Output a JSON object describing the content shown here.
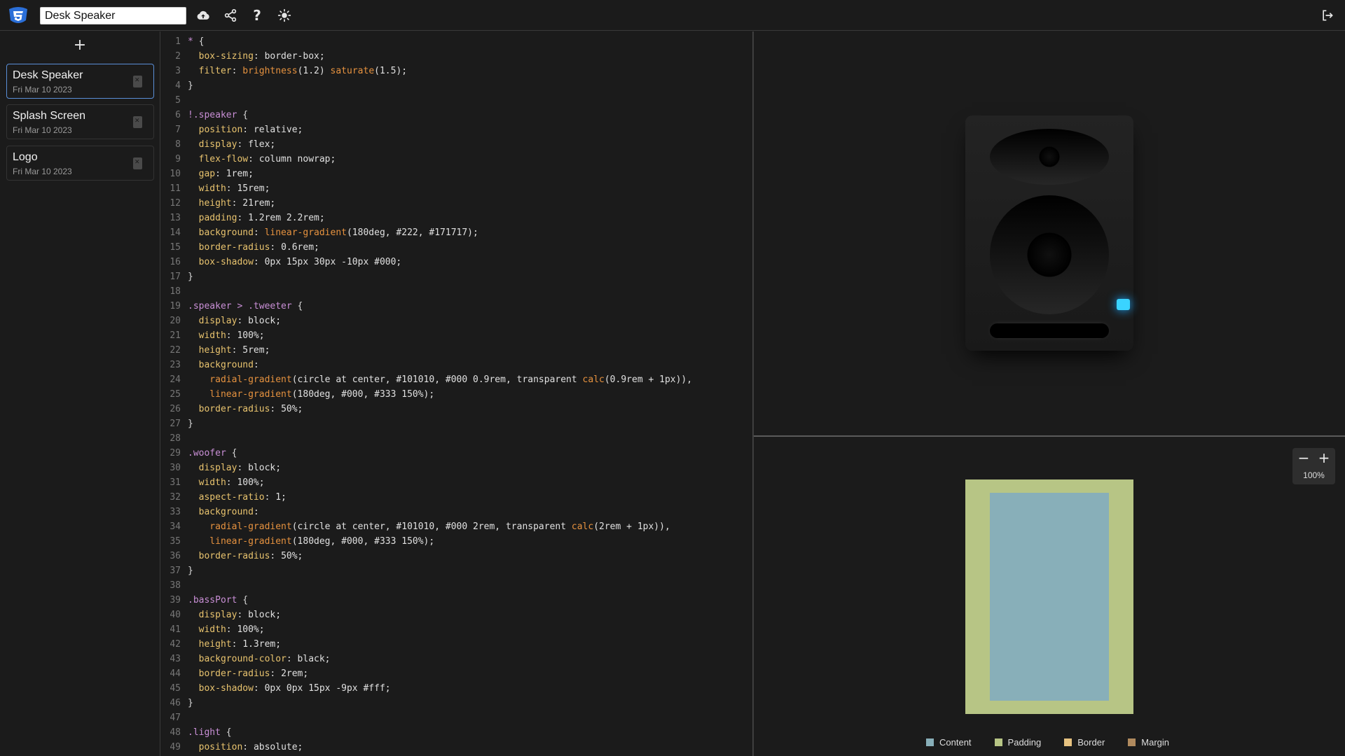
{
  "header": {
    "project_title": "Desk Speaker",
    "icons": [
      "cloud-upload-icon",
      "share-icon",
      "help-icon",
      "theme-sun-icon",
      "logout-icon"
    ],
    "help_glyph": "?"
  },
  "sidebar": {
    "add_label": "+",
    "projects": [
      {
        "name": "Desk Speaker",
        "date": "Fri Mar 10 2023",
        "active": true
      },
      {
        "name": "Splash Screen",
        "date": "Fri Mar 10 2023",
        "active": false
      },
      {
        "name": "Logo",
        "date": "Fri Mar 10 2023",
        "active": false
      }
    ]
  },
  "editor": {
    "lines": [
      [
        [
          "sel",
          "* "
        ],
        [
          "punc",
          "{"
        ]
      ],
      [
        [
          "prop",
          "  box-sizing"
        ],
        [
          "punc",
          ": "
        ],
        [
          "val",
          "border-box;"
        ]
      ],
      [
        [
          "prop",
          "  filter"
        ],
        [
          "punc",
          ": "
        ],
        [
          "fn",
          "brightness"
        ],
        [
          "val",
          "(1.2) "
        ],
        [
          "fn",
          "saturate"
        ],
        [
          "val",
          "(1.5);"
        ]
      ],
      [
        [
          "punc",
          "}"
        ]
      ],
      [],
      [
        [
          "sel",
          "!.speaker "
        ],
        [
          "punc",
          "{"
        ]
      ],
      [
        [
          "prop",
          "  position"
        ],
        [
          "punc",
          ": "
        ],
        [
          "val",
          "relative;"
        ]
      ],
      [
        [
          "prop",
          "  display"
        ],
        [
          "punc",
          ": "
        ],
        [
          "val",
          "flex;"
        ]
      ],
      [
        [
          "prop",
          "  flex-flow"
        ],
        [
          "punc",
          ": "
        ],
        [
          "val",
          "column nowrap;"
        ]
      ],
      [
        [
          "prop",
          "  gap"
        ],
        [
          "punc",
          ": "
        ],
        [
          "val",
          "1rem;"
        ]
      ],
      [
        [
          "prop",
          "  width"
        ],
        [
          "punc",
          ": "
        ],
        [
          "val",
          "15rem;"
        ]
      ],
      [
        [
          "prop",
          "  height"
        ],
        [
          "punc",
          ": "
        ],
        [
          "val",
          "21rem;"
        ]
      ],
      [
        [
          "prop",
          "  padding"
        ],
        [
          "punc",
          ": "
        ],
        [
          "val",
          "1.2rem 2.2rem;"
        ]
      ],
      [
        [
          "prop",
          "  background"
        ],
        [
          "punc",
          ": "
        ],
        [
          "fn",
          "linear-gradient"
        ],
        [
          "val",
          "(180deg, #222, #171717);"
        ]
      ],
      [
        [
          "prop",
          "  border-radius"
        ],
        [
          "punc",
          ": "
        ],
        [
          "val",
          "0.6rem;"
        ]
      ],
      [
        [
          "prop",
          "  box-shadow"
        ],
        [
          "punc",
          ": "
        ],
        [
          "val",
          "0px 15px 30px -10px #000;"
        ]
      ],
      [
        [
          "punc",
          "}"
        ]
      ],
      [],
      [
        [
          "sel",
          ".speaker > .tweeter "
        ],
        [
          "punc",
          "{"
        ]
      ],
      [
        [
          "prop",
          "  display"
        ],
        [
          "punc",
          ": "
        ],
        [
          "val",
          "block;"
        ]
      ],
      [
        [
          "prop",
          "  width"
        ],
        [
          "punc",
          ": "
        ],
        [
          "val",
          "100%;"
        ]
      ],
      [
        [
          "prop",
          "  height"
        ],
        [
          "punc",
          ": "
        ],
        [
          "val",
          "5rem;"
        ]
      ],
      [
        [
          "prop",
          "  background"
        ],
        [
          "punc",
          ":"
        ]
      ],
      [
        [
          "fn",
          "    radial-gradient"
        ],
        [
          "val",
          "(circle at center, #101010, #000 0.9rem, transparent "
        ],
        [
          "fn",
          "calc"
        ],
        [
          "val",
          "(0.9rem + 1px)),"
        ]
      ],
      [
        [
          "fn",
          "    linear-gradient"
        ],
        [
          "val",
          "(180deg, #000, #333 150%);"
        ]
      ],
      [
        [
          "prop",
          "  border-radius"
        ],
        [
          "punc",
          ": "
        ],
        [
          "val",
          "50%;"
        ]
      ],
      [
        [
          "punc",
          "}"
        ]
      ],
      [],
      [
        [
          "sel",
          ".woofer "
        ],
        [
          "punc",
          "{"
        ]
      ],
      [
        [
          "prop",
          "  display"
        ],
        [
          "punc",
          ": "
        ],
        [
          "val",
          "block;"
        ]
      ],
      [
        [
          "prop",
          "  width"
        ],
        [
          "punc",
          ": "
        ],
        [
          "val",
          "100%;"
        ]
      ],
      [
        [
          "prop",
          "  aspect-ratio"
        ],
        [
          "punc",
          ": "
        ],
        [
          "val",
          "1;"
        ]
      ],
      [
        [
          "prop",
          "  background"
        ],
        [
          "punc",
          ":"
        ]
      ],
      [
        [
          "fn",
          "    radial-gradient"
        ],
        [
          "val",
          "(circle at center, #101010, #000 2rem, transparent "
        ],
        [
          "fn",
          "calc"
        ],
        [
          "val",
          "(2rem + 1px)),"
        ]
      ],
      [
        [
          "fn",
          "    linear-gradient"
        ],
        [
          "val",
          "(180deg, #000, #333 150%);"
        ]
      ],
      [
        [
          "prop",
          "  border-radius"
        ],
        [
          "punc",
          ": "
        ],
        [
          "val",
          "50%;"
        ]
      ],
      [
        [
          "punc",
          "}"
        ]
      ],
      [],
      [
        [
          "sel",
          ".bassPort "
        ],
        [
          "punc",
          "{"
        ]
      ],
      [
        [
          "prop",
          "  display"
        ],
        [
          "punc",
          ": "
        ],
        [
          "val",
          "block;"
        ]
      ],
      [
        [
          "prop",
          "  width"
        ],
        [
          "punc",
          ": "
        ],
        [
          "val",
          "100%;"
        ]
      ],
      [
        [
          "prop",
          "  height"
        ],
        [
          "punc",
          ": "
        ],
        [
          "val",
          "1.3rem;"
        ]
      ],
      [
        [
          "prop",
          "  background-color"
        ],
        [
          "punc",
          ": "
        ],
        [
          "val",
          "black;"
        ]
      ],
      [
        [
          "prop",
          "  border-radius"
        ],
        [
          "punc",
          ": "
        ],
        [
          "val",
          "2rem;"
        ]
      ],
      [
        [
          "prop",
          "  box-shadow"
        ],
        [
          "punc",
          ": "
        ],
        [
          "val",
          "0px 0px 15px -9px #fff;"
        ]
      ],
      [
        [
          "punc",
          "}"
        ]
      ],
      [],
      [
        [
          "sel",
          ".light "
        ],
        [
          "punc",
          "{"
        ]
      ],
      [
        [
          "prop",
          "  position"
        ],
        [
          "punc",
          ": "
        ],
        [
          "val",
          "absolute;"
        ]
      ]
    ]
  },
  "zoom": {
    "minus": "−",
    "plus": "+",
    "value": "100%"
  },
  "legend": [
    {
      "label": "Content",
      "color": "#88afb9"
    },
    {
      "label": "Padding",
      "color": "#b7c585"
    },
    {
      "label": "Border",
      "color": "#e6c280"
    },
    {
      "label": "Margin",
      "color": "#b08a5e"
    }
  ],
  "colors": {
    "accent_light": "#3ad3ff",
    "active_border": "#5a8fd8"
  }
}
